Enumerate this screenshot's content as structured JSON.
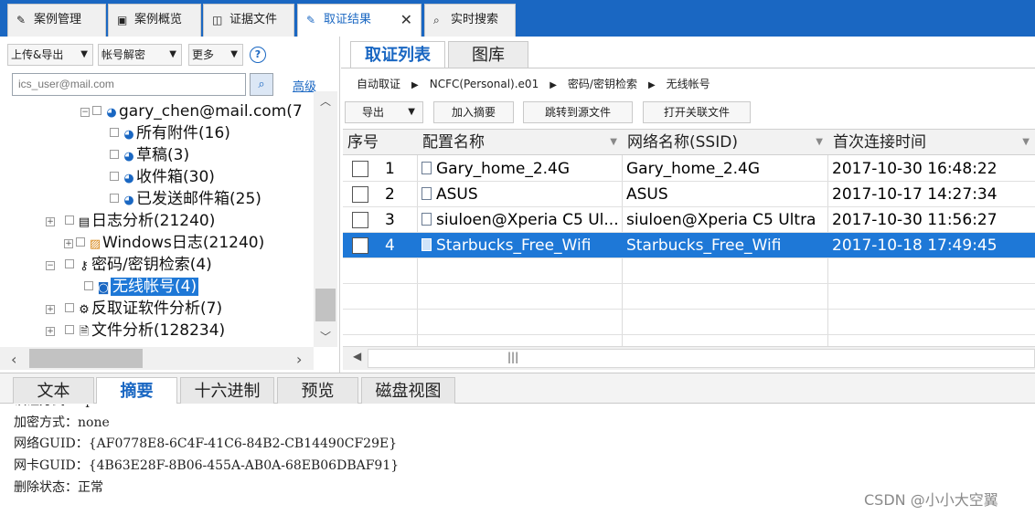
{
  "top_tabs": [
    {
      "label": "案例管理",
      "icon": "case-edit-icon"
    },
    {
      "label": "案例概览",
      "icon": "overview-icon"
    },
    {
      "label": "证据文件",
      "icon": "evidence-file-icon"
    },
    {
      "label": "取证结果",
      "icon": "result-edit-icon",
      "close": "✕"
    },
    {
      "label": "实时搜索",
      "icon": "search-icon"
    }
  ],
  "left_toolbar": {
    "upload_export": "上传&导出",
    "decrypt": "帐号解密",
    "more": "更多",
    "help": "?"
  },
  "search": {
    "value": "ics_user@mail.com",
    "advanced": "高级"
  },
  "tree": [
    {
      "label": "gary_chen@mail.com(7"
    },
    {
      "label": "所有附件(16)"
    },
    {
      "label": "草稿(3)"
    },
    {
      "label": "收件箱(30)"
    },
    {
      "label": "已发送邮件箱(25)"
    },
    {
      "label": "日志分析(21240)"
    },
    {
      "label": "Windows日志(21240)"
    },
    {
      "label": "密码/密钥检索(4)"
    },
    {
      "label": "无线帐号(4)"
    },
    {
      "label": "反取证软件分析(7)"
    },
    {
      "label": "文件分析(128234)"
    }
  ],
  "right_tabs": [
    "取证列表",
    "图库"
  ],
  "breadcrumb": [
    "自动取证",
    "NCFC(Personal).e01",
    "密码/密钥检索",
    "无线帐号"
  ],
  "toolbar": {
    "export": "导出",
    "add_summary": "加入摘要",
    "jump_source": "跳转到源文件",
    "open_related": "打开关联文件"
  },
  "table": {
    "columns": [
      "序号",
      "配置名称",
      "网络名称(SSID)",
      "首次连接时间"
    ],
    "rows": [
      {
        "no": "1",
        "config": "Gary_home_2.4G",
        "ssid": "Gary_home_2.4G",
        "time": "2017-10-30 16:48:22",
        "selected": false
      },
      {
        "no": "2",
        "config": "ASUS",
        "ssid": "ASUS",
        "time": "2017-10-17 14:27:34",
        "selected": false
      },
      {
        "no": "3",
        "config": "siuloen@Xperia C5 Ul...",
        "ssid": "siuloen@Xperia C5 Ultra",
        "time": "2017-10-30 11:56:27",
        "selected": false
      },
      {
        "no": "4",
        "config": "Starbucks_Free_Wifi",
        "ssid": "Starbucks_Free_Wifi",
        "time": "2017-10-18 17:49:45",
        "selected": true
      }
    ]
  },
  "bottom_tabs": [
    "文本",
    "摘要",
    "十六进制",
    "预览",
    "磁盘视图"
  ],
  "details": [
    "认证方式：open",
    "加密方式：none",
    "网络GUID：{AF0778E8-6C4F-41C6-84B2-CB14490CF29E}",
    "网卡GUID：{4B63E28F-8B06-455A-AB0A-68EB06DBAF91}",
    "删除状态：正常"
  ],
  "watermark": "CSDN @小小大空翼",
  "colors": {
    "accent": "#1a67c2",
    "selection": "#1e78d7"
  }
}
